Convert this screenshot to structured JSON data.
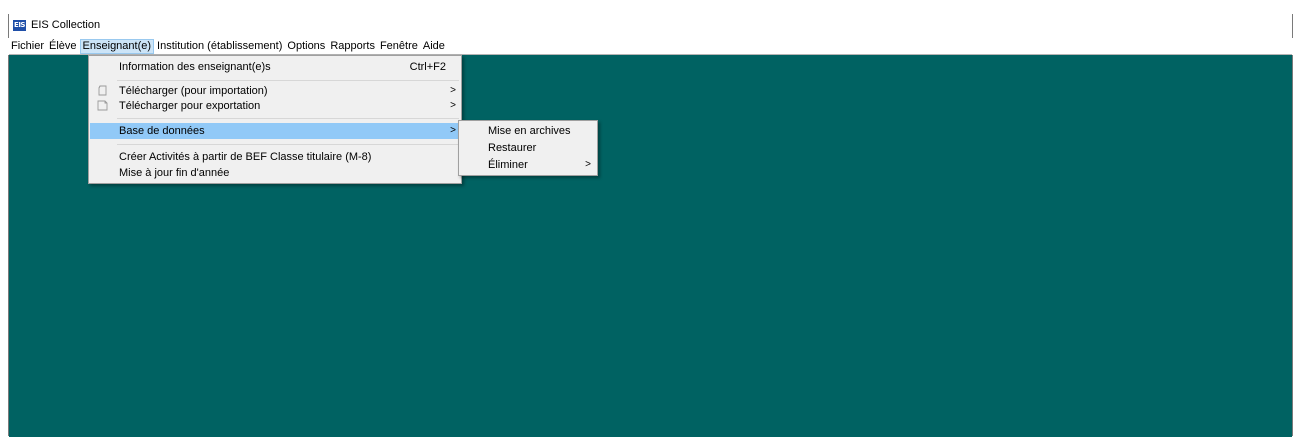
{
  "window": {
    "title": "EIS Collection",
    "logo_text": "EIS"
  },
  "menu_bar": {
    "items": [
      {
        "label": "Fichier",
        "active": false
      },
      {
        "label": "Élève",
        "active": false
      },
      {
        "label": "Enseignant(e)",
        "active": true
      },
      {
        "label": "Institution (établissement)",
        "active": false
      },
      {
        "label": "Options",
        "active": false
      },
      {
        "label": "Rapports",
        "active": false
      },
      {
        "label": "Fenêtre",
        "active": false
      },
      {
        "label": "Aide",
        "active": false
      }
    ]
  },
  "dropdown": {
    "items": [
      {
        "label": "Information des enseignant(e)s",
        "shortcut": "Ctrl+F2"
      },
      {
        "label": "Télécharger (pour importation)",
        "submenu_arrow": ">",
        "icon": "download-icon"
      },
      {
        "label": "Télécharger pour exportation",
        "submenu_arrow": ">",
        "icon": "upload-icon"
      },
      {
        "label": "Base de données",
        "submenu_arrow": ">",
        "highlighted": true
      },
      {
        "label": "Créer Activités à partir de BEF Classe titulaire (M-8)"
      },
      {
        "label": "Mise à jour fin d'année"
      }
    ]
  },
  "submenu": {
    "items": [
      {
        "label": "Mise en archives"
      },
      {
        "label": "Restaurer"
      },
      {
        "label": "Éliminer",
        "submenu_arrow": ">"
      }
    ]
  },
  "colors": {
    "client_background": "#006262",
    "menu_background": "#f0f0f0",
    "highlight": "#91c9f7",
    "active_menu": "#cce4f7",
    "logo": "#1f4fa8"
  }
}
